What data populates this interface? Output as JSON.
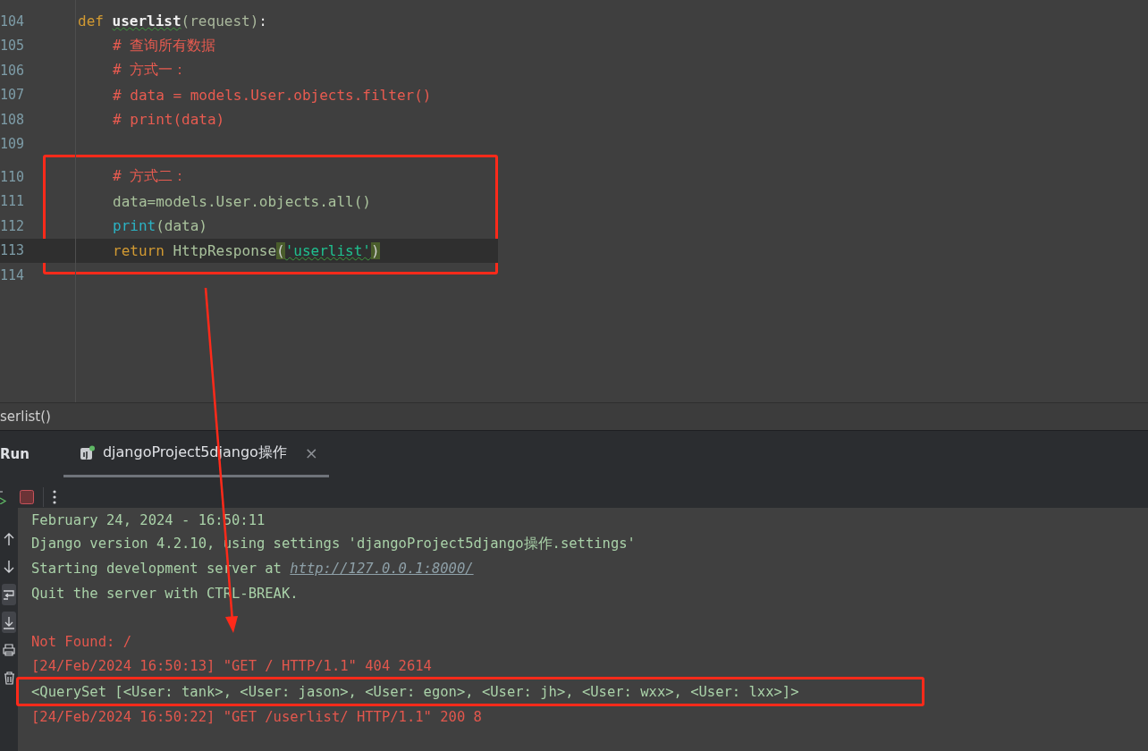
{
  "editor": {
    "lines": [
      {
        "number": "104",
        "kind": "signature",
        "current": false,
        "tokens": [
          {
            "kind": "keyword",
            "text": "def "
          },
          {
            "kind": "function",
            "text": "userlist"
          },
          {
            "kind": "param",
            "text": "(request)"
          },
          {
            "kind": "plain",
            "text": ":"
          }
        ]
      },
      {
        "number": "105",
        "kind": "body",
        "current": false,
        "tokens": [
          {
            "kind": "comment",
            "text": "# 查询所有数据"
          }
        ]
      },
      {
        "number": "106",
        "kind": "body",
        "current": false,
        "tokens": [
          {
            "kind": "comment",
            "text": "# 方式一："
          }
        ]
      },
      {
        "number": "107",
        "kind": "body",
        "current": false,
        "tokens": [
          {
            "kind": "comment",
            "text": "# data = models.User.objects.filter()"
          }
        ]
      },
      {
        "number": "108",
        "kind": "body",
        "current": false,
        "tokens": [
          {
            "kind": "comment",
            "text": "# print(data)"
          }
        ]
      },
      {
        "number": "109",
        "kind": "blank",
        "current": false
      },
      {
        "number": "110",
        "kind": "body",
        "current": false,
        "boxed": true,
        "tokens": [
          {
            "kind": "comment",
            "text": "# 方式二："
          }
        ]
      },
      {
        "number": "111",
        "kind": "body",
        "current": false,
        "boxed": true,
        "tokens": [
          {
            "kind": "code",
            "text": "data=models.User.objects.all()"
          }
        ]
      },
      {
        "number": "112",
        "kind": "body",
        "current": false,
        "boxed": true,
        "tokens": [
          {
            "kind": "builtin",
            "text": "print"
          },
          {
            "kind": "code",
            "text": "(data)"
          }
        ]
      },
      {
        "number": "113",
        "kind": "body",
        "current": true,
        "boxed": true,
        "tokens": [
          {
            "kind": "keyword",
            "text": "return "
          },
          {
            "kind": "code",
            "text": "HttpResponse"
          },
          {
            "kind": "paren",
            "text": "("
          },
          {
            "kind": "string",
            "text": "'userlist'"
          },
          {
            "kind": "paren",
            "text": ")"
          }
        ]
      },
      {
        "number": "114",
        "kind": "blank",
        "current": false
      }
    ]
  },
  "breadcrumb": "serlist()",
  "run_panel": {
    "title": "Run",
    "tabs": [
      {
        "label": "djangoProject5django操作",
        "selected": true,
        "close": "×"
      }
    ],
    "tools": [
      {
        "kind": "up",
        "selected": false
      },
      {
        "kind": "down",
        "selected": false
      },
      {
        "kind": "wrap",
        "selected": true
      },
      {
        "kind": "scroll-end",
        "selected": true
      },
      {
        "kind": "print",
        "selected": false
      },
      {
        "kind": "trash",
        "selected": false
      }
    ],
    "console": [
      {
        "kind": "info",
        "segments": [
          {
            "kind": "text",
            "text": "February 24, 2024 - 16:50:11"
          }
        ]
      },
      {
        "kind": "info",
        "segments": [
          {
            "kind": "text",
            "text": "Django version 4.2.10, using settings 'djangoProject5django操作.settings'"
          }
        ]
      },
      {
        "kind": "info",
        "segments": [
          {
            "kind": "text",
            "text": "Starting development server at "
          },
          {
            "kind": "link",
            "text": "http://127.0.0.1:8000/"
          }
        ]
      },
      {
        "kind": "info",
        "segments": [
          {
            "kind": "text",
            "text": "Quit the server with CTRL-BREAK."
          }
        ]
      },
      {
        "kind": "blank"
      },
      {
        "kind": "error",
        "segments": [
          {
            "kind": "text",
            "text": "Not Found: /"
          }
        ]
      },
      {
        "kind": "error",
        "segments": [
          {
            "kind": "text",
            "text": "[24/Feb/2024 16:50:13] \"GET / HTTP/1.1\" 404 2614"
          }
        ]
      },
      {
        "kind": "info",
        "boxed": true,
        "segments": [
          {
            "kind": "text",
            "text": "<QuerySet [<User: tank>, <User: jason>, <User: egon>, <User: jh>, <User: wxx>, <User: lxx>]>"
          }
        ]
      },
      {
        "kind": "error",
        "segments": [
          {
            "kind": "text",
            "text": "[24/Feb/2024 16:50:22] \"GET /userlist/ HTTP/1.1\" 200 8"
          }
        ]
      }
    ]
  }
}
